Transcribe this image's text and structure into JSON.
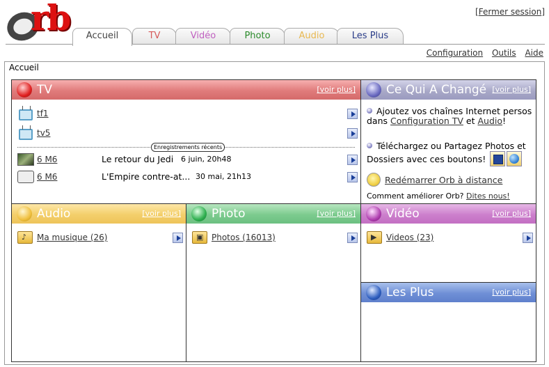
{
  "app": {
    "logo_text": "orb",
    "logout": "Fermer session"
  },
  "tabs": [
    {
      "label": "Accueil",
      "color": "#444444",
      "active": true
    },
    {
      "label": "TV",
      "color": "#d55a5a"
    },
    {
      "label": "Vidéo",
      "color": "#c060c0"
    },
    {
      "label": "Photo",
      "color": "#2a8a2a"
    },
    {
      "label": "Audio",
      "color": "#e8b850"
    },
    {
      "label": "Les Plus",
      "color": "#2a3c88"
    }
  ],
  "subnav": {
    "config": "Configuration",
    "tools": "Outils",
    "help": "Aide"
  },
  "breadcrumb": "Accueil",
  "voir_plus": "[voir plus]",
  "tv": {
    "title": "TV",
    "channels": [
      "tf1",
      "tv5"
    ],
    "recordings_label": "Enregistrements récents",
    "recordings": [
      {
        "channel": "6 M6",
        "title": "Le retour du Jedi",
        "date": "6 juin, 20h48"
      },
      {
        "channel": "6 M6",
        "title": "L'Empire contre-at...",
        "date": "30 mai, 21h13"
      }
    ]
  },
  "changes": {
    "title": "Ce Qui A Changé",
    "item1_pre": "Ajoutez vos chaînes Internet persos dans ",
    "item1_link1": "Configuration TV",
    "item1_mid": " et ",
    "item1_link2": "Audio",
    "item1_post": "!",
    "item2": "Téléchargez ou Partagez Photos et Dossiers avec ces boutons!",
    "restart": "Redémarrer Orb à distance",
    "improve": "Comment améliorer Orb?",
    "tell_us": "Dites nous!"
  },
  "audio": {
    "title": "Audio",
    "item": "Ma musique (26)"
  },
  "photo": {
    "title": "Photo",
    "item": "Photos (16013)"
  },
  "video": {
    "title": "Vidéo",
    "item": "Videos (23)"
  },
  "plus": {
    "title": "Les Plus"
  },
  "colors": {
    "tv": "#e07b7b",
    "changes": "#a9a9c8",
    "audio": "#f3cf6b",
    "photo": "#7ccb8e",
    "video": "#cc7fcc",
    "plus": "#6f8fd6"
  }
}
